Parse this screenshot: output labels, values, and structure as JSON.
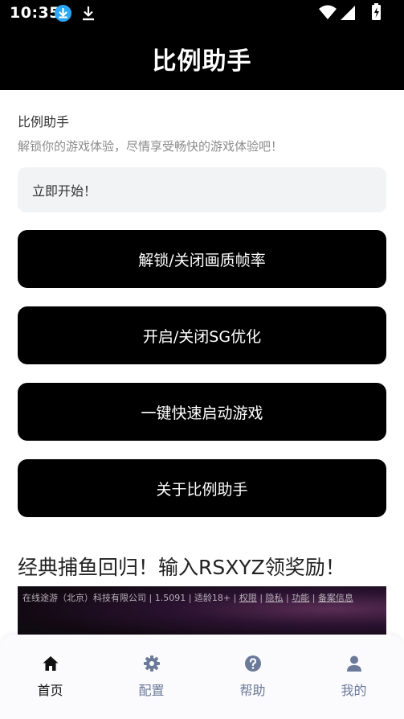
{
  "status_bar": {
    "time": "10:35"
  },
  "header": {
    "title": "比例助手"
  },
  "intro": {
    "subtitle": "比例助手",
    "tagline": "解锁你的游戏体验，尽情享受畅快的游戏体验吧！"
  },
  "start_box": {
    "text": "立即开始！"
  },
  "actions": [
    {
      "label": "解锁/关闭画质帧率"
    },
    {
      "label": "开启/关闭SG优化"
    },
    {
      "label": "一键快速启动游戏"
    },
    {
      "label": "关于比例助手"
    }
  ],
  "promo": {
    "title": "经典捕鱼回归！输入RSXYZ领奖励！",
    "company": "在线途游（北京）科技有限公司",
    "version": "1.5091",
    "age": "适龄18+",
    "links": [
      "权限",
      "隐私",
      "功能",
      "备案信息"
    ]
  },
  "tabs": [
    {
      "label": "首页",
      "icon": "home-icon",
      "active": true
    },
    {
      "label": "配置",
      "icon": "gear-icon",
      "active": false
    },
    {
      "label": "帮助",
      "icon": "help-icon",
      "active": false
    },
    {
      "label": "我的",
      "icon": "user-icon",
      "active": false
    }
  ],
  "colors": {
    "header_bg": "#000000",
    "button_bg": "#000000",
    "tab_active": "#111111",
    "tab_inactive": "#6b7a99",
    "download_badge": "#2aa7f5"
  }
}
